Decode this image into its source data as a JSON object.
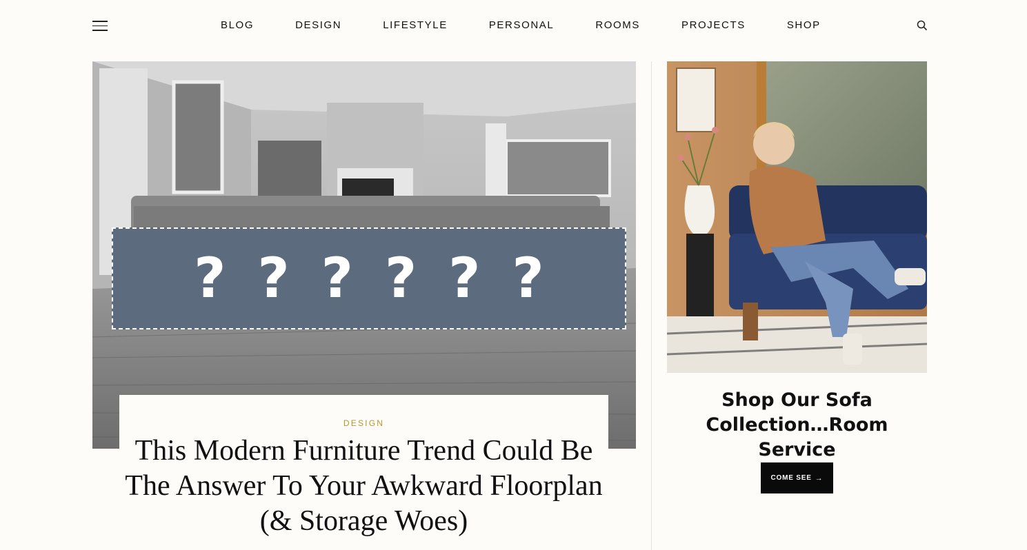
{
  "nav": {
    "items": [
      {
        "label": "BLOG"
      },
      {
        "label": "DESIGN"
      },
      {
        "label": "LIFESTYLE"
      },
      {
        "label": "PERSONAL"
      },
      {
        "label": "ROOMS"
      },
      {
        "label": "PROJECTS"
      },
      {
        "label": "SHOP"
      }
    ],
    "menu_icon": "hamburger-icon",
    "search_icon": "search-icon"
  },
  "hero": {
    "overlay_text": "? ? ? ? ? ?",
    "category": "DESIGN",
    "title": "This Modern Furniture Trend Could Be The Answer To Your Awkward Floorplan (& Storage Woes)"
  },
  "side_ad": {
    "title": "Shop Our Sofa Collection…Room Service",
    "cta_label": "COME SEE",
    "cta_icon": "arrow-right-icon"
  },
  "colors": {
    "category_gold": "#b8952b",
    "overlay_slate": "#5d6b7f",
    "cta_black": "#0a0a0a",
    "page_bg": "#fdfcf9"
  }
}
